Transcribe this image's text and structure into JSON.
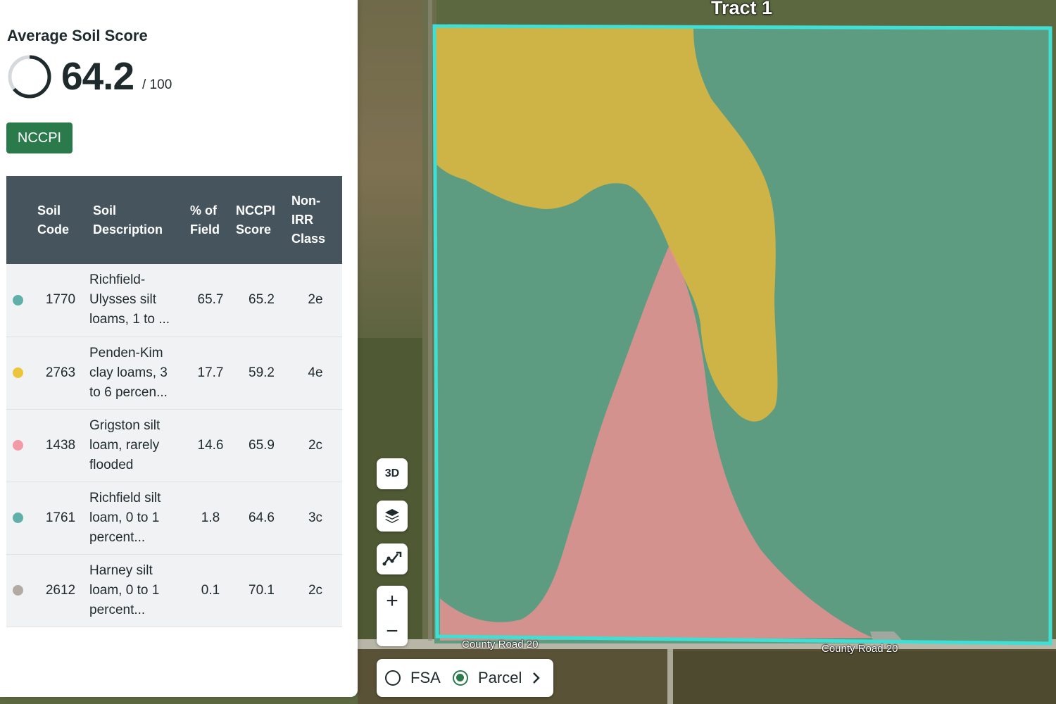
{
  "panel": {
    "score_title": "Average Soil Score",
    "score_value": "64.2",
    "score_max": "/ 100",
    "score_fraction": 0.642,
    "method_button": "NCCPI",
    "table": {
      "headers": {
        "code": "Soil\nCode",
        "description": "Soil\nDescription",
        "pct": "% of\nField",
        "score": "NCCPI\nScore",
        "class": "Non-\nIRR\nClass"
      },
      "rows": [
        {
          "color": "#5fb0a8",
          "code": "1770",
          "description": "Richfield-\nUlysses silt\nloams, 1 to ...",
          "pct": "65.7",
          "score": "65.2",
          "class": "2e"
        },
        {
          "color": "#ecc53d",
          "code": "2763",
          "description": "Penden-Kim\nclay loams, 3\nto 6 percen...",
          "pct": "17.7",
          "score": "59.2",
          "class": "4e"
        },
        {
          "color": "#f29aa6",
          "code": "1438",
          "description": "Grigston silt\nloam, rarely\nflooded",
          "pct": "14.6",
          "score": "65.9",
          "class": "2c"
        },
        {
          "color": "#5fb0a8",
          "code": "1761",
          "description": "Richfield silt\nloam, 0 to 1\npercent...",
          "pct": "1.8",
          "score": "64.6",
          "class": "3c"
        },
        {
          "color": "#b3aaa4",
          "code": "2612",
          "description": "Harney silt\nloam, 0 to 1\npercent...",
          "pct": "0.1",
          "score": "70.1",
          "class": "2c"
        }
      ]
    }
  },
  "map": {
    "tract_label": "Tract 1",
    "road_label_1": "County Road 20",
    "road_label_2": "County Road 20",
    "boundary_color": "#3ee0d6",
    "controls": {
      "three_d": "3D",
      "zoom_in": "+",
      "zoom_out": "−",
      "layers_icon": "layers-icon",
      "draw_icon": "draw-icon"
    },
    "boundary_toggle": {
      "fsa_label": "FSA",
      "parcel_label": "Parcel",
      "selected": "Parcel"
    }
  }
}
